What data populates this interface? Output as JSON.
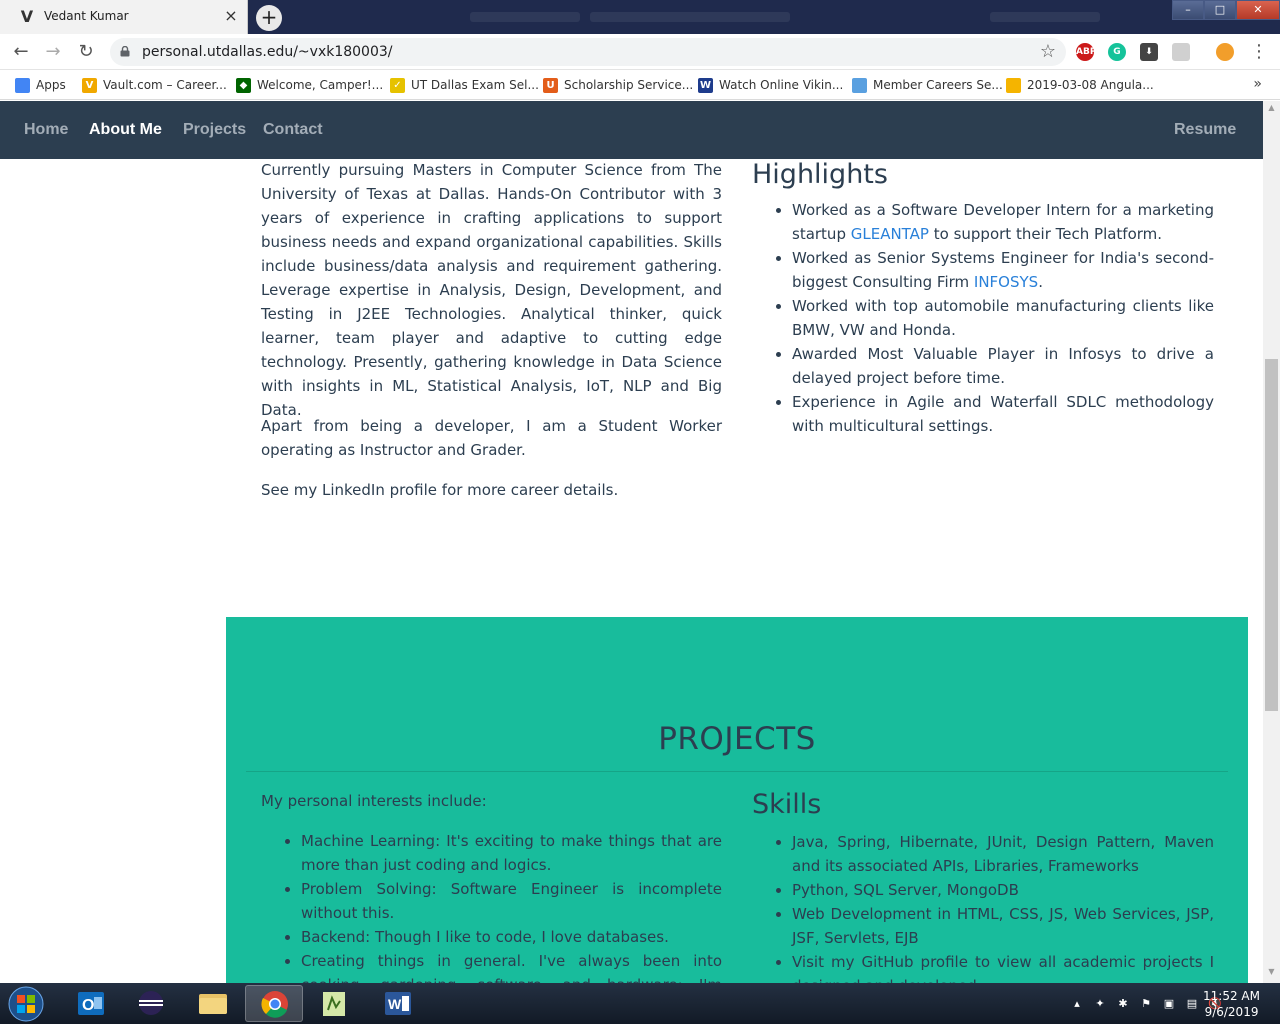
{
  "browser": {
    "tab_title": "Vedant Kumar",
    "tab_close": "×",
    "new_tab": "+",
    "url": "personal.utdallas.edu/~vxk180003/",
    "nav": {
      "back": "←",
      "forward": "→",
      "reload": "↻"
    },
    "window_controls": {
      "minimize": "–",
      "maximize": "□",
      "close": "✕"
    },
    "extensions": [
      {
        "name": "adblock-plus-icon",
        "label": "ABP",
        "color": "#cc1a1a"
      },
      {
        "name": "grammarly-icon",
        "label": "G",
        "color": "#15c39a"
      },
      {
        "name": "download-icon",
        "label": "⬇",
        "color": "#444444"
      },
      {
        "name": "extension-icon",
        "label": "",
        "color": "#d0d0d0"
      },
      {
        "name": "profile-avatar-icon",
        "label": "",
        "color": "#f29e2b"
      }
    ],
    "menu": "⋮"
  },
  "bookmarks": [
    {
      "label": "Apps",
      "icon_color": "#4285f4",
      "icon": "apps-grid-icon"
    },
    {
      "label": "Vault.com – Career...",
      "icon_color": "#f0a800",
      "icon": "vault-icon"
    },
    {
      "label": "Welcome, Camper!...",
      "icon_color": "#006400",
      "icon": "freecodecamp-icon"
    },
    {
      "label": "UT Dallas Exam Sel...",
      "icon_color": "#e6c200",
      "icon": "notepad-icon"
    },
    {
      "label": "Scholarship Service...",
      "icon_color": "#e35d1a",
      "icon": "utd-icon"
    },
    {
      "label": "Watch Online Vikin...",
      "icon_color": "#1e3c8c",
      "icon": "video-icon"
    },
    {
      "label": "Member Careers Se...",
      "icon_color": "#5aa0e0",
      "icon": "shell-icon"
    },
    {
      "label": "2019-03-08 Angula...",
      "icon_color": "#f5b400",
      "icon": "slides-icon"
    }
  ],
  "bookmarks_more": "»",
  "site_nav": {
    "links": [
      "Home",
      "About Me",
      "Projects",
      "Contact"
    ],
    "resume": "Resume"
  },
  "about": {
    "paragraph1": "Currently pursuing Masters in Computer Science from The University of Texas at Dallas. Hands-On Contributor with 3 years of experience in crafting applications to support business needs and expand organizational capabilities. Skills include business/data analysis and requirement gathering. Leverage expertise in Analysis, Design, Development, and Testing in J2EE Technologies. Analytical thinker, quick learner, team player and adaptive to cutting edge technology. Presently, gathering knowledge in Data Science with insights in ML, Statistical Analysis, IoT, NLP and Big Data.",
    "paragraph2": "Apart from being a developer, I am a Student Worker operating as Instructor and Grader.",
    "paragraph3": "See my LinkedIn profile for more career details."
  },
  "highlights": {
    "title": "Highlights",
    "item1_pre": "Worked as a Software Developer Intern for a marketing startup ",
    "item1_link": "GLEANTAP",
    "item1_post": " to support their Tech Platform.",
    "item2_pre": "Worked as Senior Systems Engineer for India's second-biggest Consulting Firm ",
    "item2_link": "INFOSYS",
    "item2_post": ".",
    "item3": "Worked with top automobile manufacturing clients like BMW, VW and Honda.",
    "item4": "Awarded Most Valuable Player in Infosys to drive a delayed project before time.",
    "item5": "Experience in Agile and Waterfall SDLC methodology with multicultural settings."
  },
  "projects": {
    "title": "PROJECTS",
    "intro": "My personal interests include:",
    "interests": [
      "Machine Learning: It's exciting to make things that are more than just coding and logics.",
      "Problem Solving: Software Engineer is incomplete without this.",
      "Backend: Though I like to code, I love databases.",
      "Creating things in general. I've always been into cooking, gardening, software, and hardware; I'm constantly cooking"
    ],
    "skills_title": "Skills",
    "skills": [
      "Java, Spring, Hibernate, JUnit, Design Pattern, Maven and its associated APIs, Libraries, Frameworks",
      "Python, SQL Server, MongoDB",
      "Web Development in HTML, CSS, JS, Web Services, JSP, JSF, Servlets, EJB",
      "Visit my GitHub profile to view all academic projects I designed and developed"
    ]
  },
  "taskbar": {
    "apps": [
      "outlook-icon",
      "eclipse-icon",
      "file-explorer-icon",
      "chrome-icon",
      "notepad-plus-icon",
      "word-icon"
    ],
    "time": "11:52 AM",
    "date": "9/6/2019",
    "tray": [
      "▴",
      "✦",
      "✱",
      "⚑",
      "▣",
      "▤",
      "🔇"
    ]
  }
}
